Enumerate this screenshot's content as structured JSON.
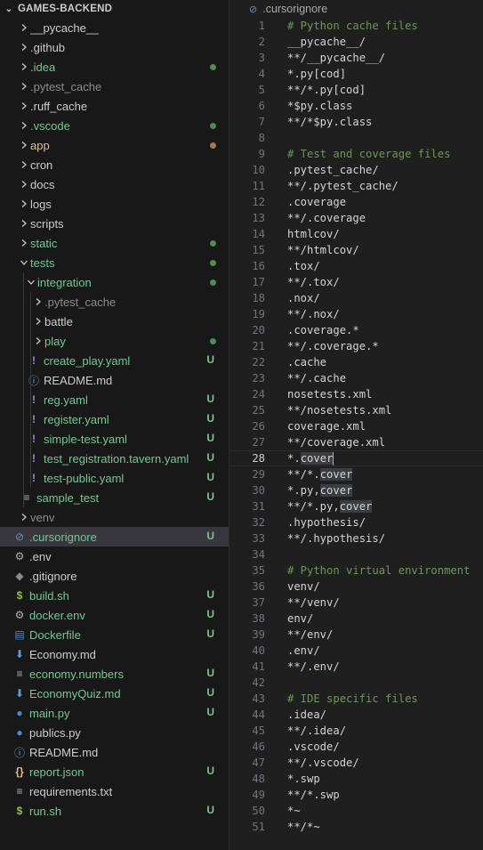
{
  "colors": {
    "tracked": "#cccccc",
    "untracked": "#73c991",
    "ignored": "#8c8c8c",
    "modified": "#e2c08d",
    "dot_green": "#4e8b57",
    "dot_amber": "#9b7e45",
    "comment": "#6a9955"
  },
  "explorer": {
    "title": "GAMES-BACKEND",
    "items": [
      {
        "name": "__pycache__",
        "type": "folder",
        "depth": 0,
        "expanded": false,
        "color": "tracked"
      },
      {
        "name": ".github",
        "type": "folder",
        "depth": 0,
        "expanded": false,
        "color": "tracked"
      },
      {
        "name": ".idea",
        "type": "folder",
        "depth": 0,
        "expanded": false,
        "color": "untracked",
        "dot": "dot_green"
      },
      {
        "name": ".pytest_cache",
        "type": "folder",
        "depth": 0,
        "expanded": false,
        "color": "ignored"
      },
      {
        "name": ".ruff_cache",
        "type": "folder",
        "depth": 0,
        "expanded": false,
        "color": "tracked"
      },
      {
        "name": ".vscode",
        "type": "folder",
        "depth": 0,
        "expanded": false,
        "color": "untracked",
        "dot": "dot_green"
      },
      {
        "name": "app",
        "type": "folder",
        "depth": 0,
        "expanded": false,
        "color": "modified",
        "dot": "dot_amber"
      },
      {
        "name": "cron",
        "type": "folder",
        "depth": 0,
        "expanded": false,
        "color": "tracked"
      },
      {
        "name": "docs",
        "type": "folder",
        "depth": 0,
        "expanded": false,
        "color": "tracked"
      },
      {
        "name": "logs",
        "type": "folder",
        "depth": 0,
        "expanded": false,
        "color": "tracked"
      },
      {
        "name": "scripts",
        "type": "folder",
        "depth": 0,
        "expanded": false,
        "color": "tracked"
      },
      {
        "name": "static",
        "type": "folder",
        "depth": 0,
        "expanded": false,
        "color": "untracked",
        "dot": "dot_green"
      },
      {
        "name": "tests",
        "type": "folder",
        "depth": 0,
        "expanded": true,
        "color": "untracked",
        "dot": "dot_green"
      },
      {
        "name": "integration",
        "type": "folder",
        "depth": 1,
        "expanded": true,
        "color": "untracked",
        "dot": "dot_green"
      },
      {
        "name": ".pytest_cache",
        "type": "folder",
        "depth": 2,
        "expanded": false,
        "color": "ignored"
      },
      {
        "name": "battle",
        "type": "folder",
        "depth": 2,
        "expanded": false,
        "color": "tracked"
      },
      {
        "name": "play",
        "type": "folder",
        "depth": 2,
        "expanded": false,
        "color": "untracked",
        "dot": "dot_green"
      },
      {
        "name": "create_play.yaml",
        "type": "file",
        "icon": "yaml-icon",
        "depth": 2,
        "color": "untracked",
        "badge": "U"
      },
      {
        "name": "README.md",
        "type": "file",
        "icon": "info-icon",
        "depth": 2,
        "color": "tracked"
      },
      {
        "name": "reg.yaml",
        "type": "file",
        "icon": "yaml-icon",
        "depth": 2,
        "color": "untracked",
        "badge": "U"
      },
      {
        "name": "register.yaml",
        "type": "file",
        "icon": "yaml-icon",
        "depth": 2,
        "color": "untracked",
        "badge": "U"
      },
      {
        "name": "simple-test.yaml",
        "type": "file",
        "icon": "yaml-icon",
        "depth": 2,
        "color": "untracked",
        "badge": "U"
      },
      {
        "name": "test_registration.tavern.yaml",
        "type": "file",
        "icon": "yaml-icon",
        "depth": 2,
        "color": "untracked",
        "badge": "U"
      },
      {
        "name": "test-public.yaml",
        "type": "file",
        "icon": "yaml-icon",
        "depth": 2,
        "color": "untracked",
        "badge": "U"
      },
      {
        "name": "sample_test",
        "type": "file",
        "icon": "lines-icon",
        "depth": 1,
        "color": "untracked",
        "badge": "U"
      },
      {
        "name": "venv",
        "type": "folder",
        "depth": 0,
        "expanded": false,
        "color": "ignored"
      },
      {
        "name": ".cursorignore",
        "type": "file",
        "icon": "ignore-icon",
        "depth": 0,
        "color": "untracked",
        "badge": "U",
        "selected": true
      },
      {
        "name": ".env",
        "type": "file",
        "icon": "gear-icon",
        "depth": 0,
        "color": "tracked"
      },
      {
        "name": ".gitignore",
        "type": "file",
        "icon": "git-icon",
        "depth": 0,
        "color": "tracked"
      },
      {
        "name": "build.sh",
        "type": "file",
        "icon": "shell-icon",
        "depth": 0,
        "color": "untracked",
        "badge": "U"
      },
      {
        "name": "docker.env",
        "type": "file",
        "icon": "gear-icon",
        "depth": 0,
        "color": "untracked",
        "badge": "U"
      },
      {
        "name": "Dockerfile",
        "type": "file",
        "icon": "docker-icon",
        "depth": 0,
        "color": "untracked",
        "badge": "U"
      },
      {
        "name": "Economy.md",
        "type": "file",
        "icon": "markdown-icon",
        "depth": 0,
        "color": "tracked"
      },
      {
        "name": "economy.numbers",
        "type": "file",
        "icon": "lines-icon",
        "depth": 0,
        "color": "untracked",
        "badge": "U"
      },
      {
        "name": "EconomyQuiz.md",
        "type": "file",
        "icon": "markdown-icon",
        "depth": 0,
        "color": "untracked",
        "badge": "U"
      },
      {
        "name": "main.py",
        "type": "file",
        "icon": "python-icon",
        "depth": 0,
        "color": "untracked",
        "badge": "U"
      },
      {
        "name": "publics.py",
        "type": "file",
        "icon": "python-icon",
        "depth": 0,
        "color": "tracked"
      },
      {
        "name": "README.md",
        "type": "file",
        "icon": "info-icon",
        "depth": 0,
        "color": "tracked"
      },
      {
        "name": "report.json",
        "type": "file",
        "icon": "json-icon",
        "depth": 0,
        "color": "untracked",
        "badge": "U"
      },
      {
        "name": "requirements.txt",
        "type": "file",
        "icon": "lines-icon",
        "depth": 0,
        "color": "tracked"
      },
      {
        "name": "run.sh",
        "type": "file",
        "icon": "shell-icon",
        "depth": 0,
        "color": "untracked",
        "badge": "U"
      }
    ]
  },
  "editor": {
    "breadcrumb": ".cursorignore",
    "current_line": 28,
    "lines": [
      "# Python cache files",
      "__pycache__/",
      "**/__pycache__/",
      "*.py[cod]",
      "**/*.py[cod]",
      "*$py.class",
      "**/*$py.class",
      "",
      "# Test and coverage files",
      ".pytest_cache/",
      "**/.pytest_cache/",
      ".coverage",
      "**/.coverage",
      "htmlcov/",
      "**/htmlcov/",
      ".tox/",
      "**/.tox/",
      ".nox/",
      "**/.nox/",
      ".coverage.*",
      "**/.coverage.*",
      ".cache",
      "**/.cache",
      "nosetests.xml",
      "**/nosetests.xml",
      "coverage.xml",
      "**/coverage.xml",
      "*.cover",
      "**/*.cover",
      "*.py,cover",
      "**/*.py,cover",
      ".hypothesis/",
      "**/.hypothesis/",
      "",
      "# Python virtual environment",
      "venv/",
      "**/venv/",
      "env/",
      "**/env/",
      ".env/",
      "**/.env/",
      "",
      "# IDE specific files",
      ".idea/",
      "**/.idea/",
      ".vscode/",
      "**/.vscode/",
      "*.swp",
      "**/*.swp",
      "*~",
      "**/*~"
    ],
    "highlight_word": "cover",
    "highlight_lines": [
      28,
      29,
      30,
      31
    ]
  }
}
